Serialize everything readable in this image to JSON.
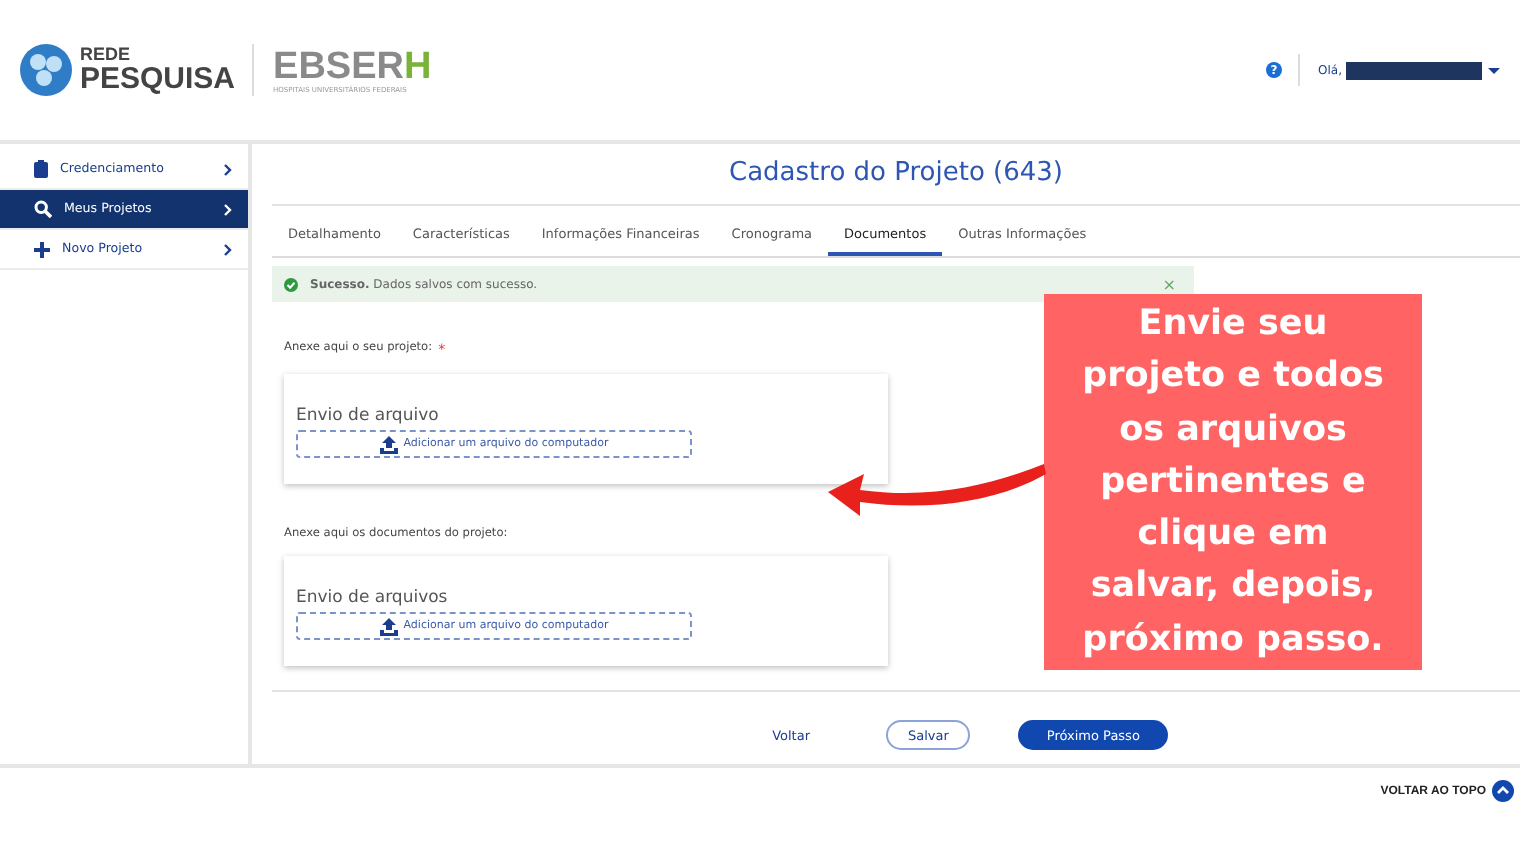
{
  "header": {
    "logo_text_top": "REDE",
    "logo_text_bottom": "PESQUISA",
    "brand": "EBSER",
    "brand_accent": "H",
    "brand_subtitle": "HOSPITAIS UNIVERSITÁRIOS FEDERAIS",
    "help_icon": "?",
    "greeting": "Olá,"
  },
  "sidebar": {
    "items": [
      {
        "label": "Credenciamento",
        "kind": "clipboard",
        "selected": false
      },
      {
        "label": "Meus Projetos",
        "kind": "search",
        "selected": true
      },
      {
        "label": "Novo Projeto",
        "kind": "plus",
        "selected": false
      }
    ]
  },
  "page_title": "Cadastro do Projeto (643)",
  "tabs": [
    {
      "label": "Detalhamento",
      "selected": false
    },
    {
      "label": "Características",
      "selected": false
    },
    {
      "label": "Informações Financeiras",
      "selected": false
    },
    {
      "label": "Cronograma",
      "selected": false
    },
    {
      "label": "Documentos",
      "selected": true
    },
    {
      "label": "Outras Informações",
      "selected": false
    }
  ],
  "alert": {
    "title": "Sucesso.",
    "message": "Dados salvos com sucesso.",
    "close": "×"
  },
  "uploads": [
    {
      "label": "Anexe aqui o seu projeto:",
      "required_mark": "*",
      "heading": "Envio de arquivo",
      "button": "Adicionar um arquivo do computador"
    },
    {
      "label": "Anexe aqui os documentos do projeto:",
      "heading": "Envio de arquivos",
      "button": "Adicionar um arquivo do computador"
    }
  ],
  "callout": "Envie seu projeto e todos os arquivos pertinentes e clique em salvar, depois, próximo passo.",
  "actions": [
    "Voltar",
    "Salvar",
    "Próximo Passo"
  ],
  "back_to_top": "VOLTAR AO TOPO"
}
